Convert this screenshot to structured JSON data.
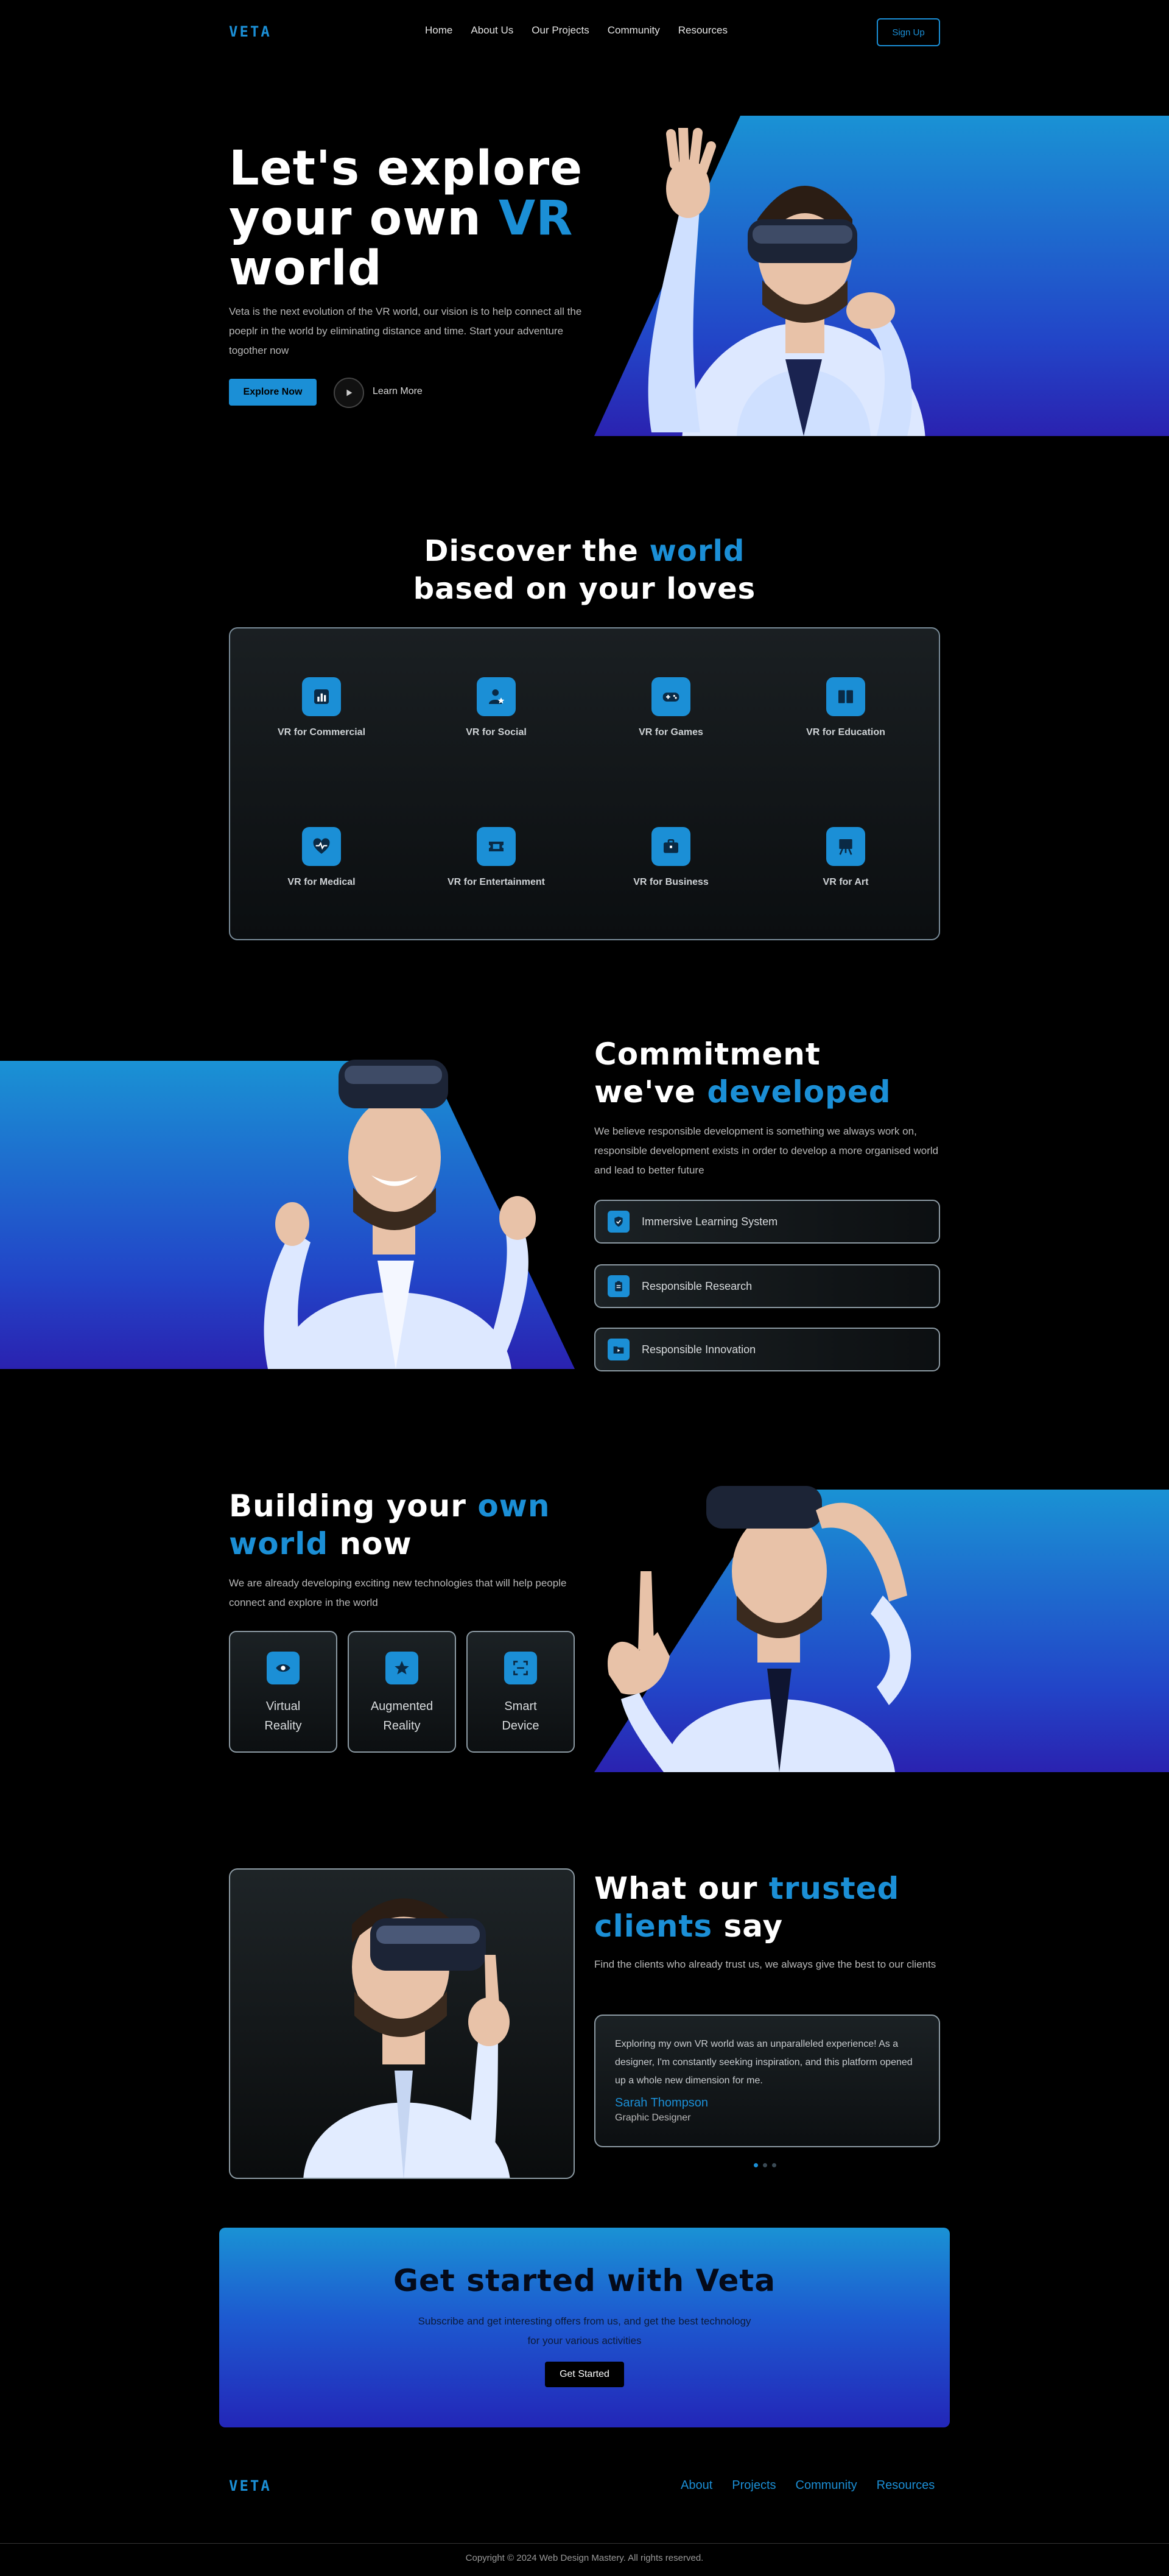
{
  "nav": {
    "logo": "VETA",
    "links": [
      "Home",
      "About Us",
      "Our Projects",
      "Community",
      "Resources"
    ],
    "signup": "Sign Up"
  },
  "hero": {
    "title_line1": "Let's explore",
    "title_line2_a": "your own ",
    "title_line2_b": "VR",
    "title_line3": "world",
    "description": "Veta is the next evolution of the VR world, our vision is to help connect all the poeplr in the world by eliminating distance and time. Start your adventure togother now",
    "primary_button": "Explore Now",
    "secondary_link": "Learn More"
  },
  "discover": {
    "title_a": "Discover the ",
    "title_b": "world",
    "title_line2": "based on your loves",
    "categories": [
      {
        "label": "VR for Commercial",
        "icon": "bar-chart-icon"
      },
      {
        "label": "VR for Social",
        "icon": "user-star-icon"
      },
      {
        "label": "VR for Games",
        "icon": "gamepad-icon"
      },
      {
        "label": "VR for Education",
        "icon": "book-icon"
      },
      {
        "label": "VR for Medical",
        "icon": "heart-pulse-icon"
      },
      {
        "label": "VR for Entertainment",
        "icon": "ticket-icon"
      },
      {
        "label": "VR for Business",
        "icon": "briefcase-icon"
      },
      {
        "label": "VR for Art",
        "icon": "easel-icon"
      }
    ]
  },
  "commitment": {
    "title_line1": "Commitment",
    "title_line2_a": "we've ",
    "title_line2_b": "developed",
    "description": "We believe responsible development is something we always work on, responsible development exists in order to develop a more organised world and lead to better future",
    "items": [
      {
        "label": "Immersive Learning System",
        "icon": "shield-icon"
      },
      {
        "label": "Responsible Research",
        "icon": "clipboard-icon"
      },
      {
        "label": "Responsible Innovation",
        "icon": "folder-icon"
      }
    ]
  },
  "building": {
    "title_a": "Building your ",
    "title_b": "own",
    "title_line2_a": "world",
    "title_line2_b": " now",
    "description": "We are already developing exciting new technologies that will help people connect and explore in the world",
    "cards": [
      {
        "line1": "Virtual",
        "line2": "Reality",
        "icon": "eye-icon"
      },
      {
        "line1": "Augmented",
        "line2": "Reality",
        "icon": "star-icon"
      },
      {
        "line1": "Smart",
        "line2": "Device",
        "icon": "scan-icon"
      }
    ]
  },
  "testimonials": {
    "title_a": "What our ",
    "title_b": "trusted",
    "title_line2_a": "clients",
    "title_line2_b": " say",
    "description": "Find the clients who already trust us, we always give the best to our clients",
    "quote": "Exploring my own VR world was an unparalleled experience! As a designer, I'm constantly seeking inspiration, and this platform opened up a whole new dimension for me.",
    "name": "Sarah Thompson",
    "role": "Graphic Designer",
    "active_dot": 0,
    "dot_count": 3
  },
  "cta": {
    "title": "Get started with Veta",
    "description": "Subscribe and get interesting offers from us, and get the best technology for your various activities",
    "button": "Get Started"
  },
  "footer": {
    "logo": "VETA",
    "links": [
      "About",
      "Projects",
      "Community",
      "Resources"
    ],
    "copyright": "Copyright © 2024 Web Design Mastery. All rights reserved."
  },
  "colors": {
    "accent": "#1b8fd6",
    "background": "#000000",
    "gradient_top": "#1a92d4",
    "gradient_bottom": "#2a22b0"
  }
}
